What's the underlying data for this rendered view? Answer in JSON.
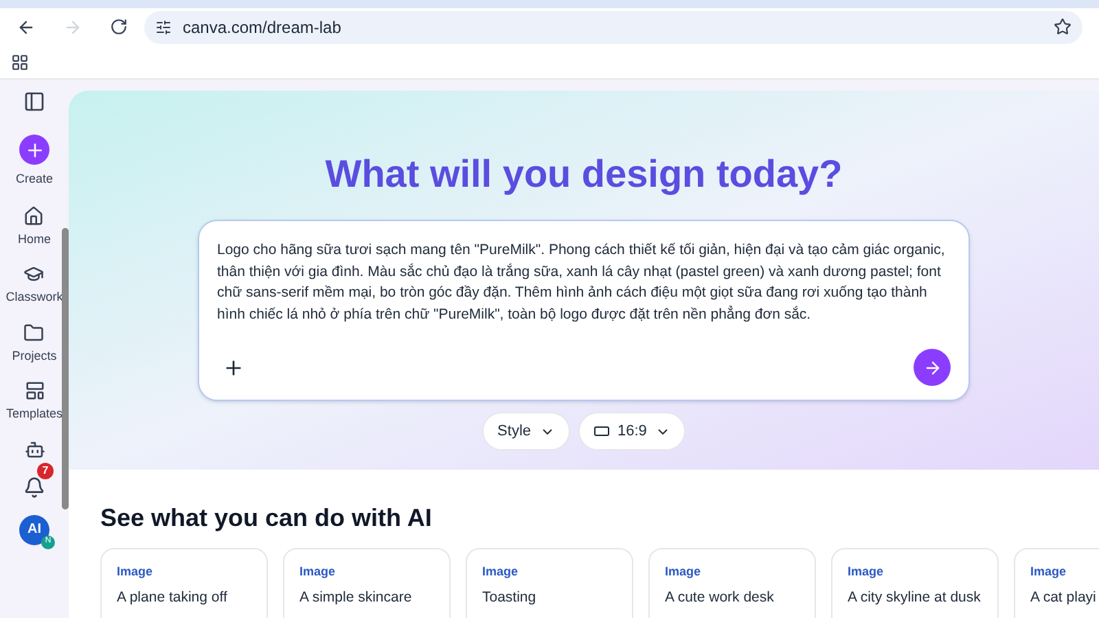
{
  "browser": {
    "url": "canva.com/dream-lab"
  },
  "sidebar": {
    "create": "Create",
    "items": [
      {
        "label": "Home"
      },
      {
        "label": "Classwork"
      },
      {
        "label": "Projects"
      },
      {
        "label": "Templates"
      }
    ],
    "notifications": "7",
    "avatar": "AI",
    "avatar_badge": "N"
  },
  "title": "What will you design today?",
  "prompt": {
    "value": "Logo cho hãng sữa tươi sạch mang tên \"PureMilk\". Phong cách thiết kế tối giản, hiện đại và tạo cảm giác organic, thân thiện với gia đình. Màu sắc chủ đạo là trắng sữa, xanh lá cây nhạt (pastel green) và xanh dương pastel; font chữ sans-serif mềm mại, bo tròn góc đầy đặn. Thêm hình ảnh cách điệu một giọt sữa đang rơi xuống tạo thành hình chiếc lá nhỏ ở phía trên chữ \"PureMilk\", toàn bộ logo được đặt trên nền phẳng đơn sắc."
  },
  "options": [
    {
      "label": "Style"
    },
    {
      "label": "16:9"
    }
  ],
  "section": {
    "heading": "See what you can do with AI",
    "cards": [
      {
        "tag": "Image",
        "text": "A plane taking off"
      },
      {
        "tag": "Image",
        "text": "A simple skincare"
      },
      {
        "tag": "Image",
        "text": "Toasting"
      },
      {
        "tag": "Image",
        "text": "A cute work desk"
      },
      {
        "tag": "Image",
        "text": "A city skyline at dusk"
      },
      {
        "tag": "Image",
        "text": "A cat playi"
      }
    ]
  }
}
